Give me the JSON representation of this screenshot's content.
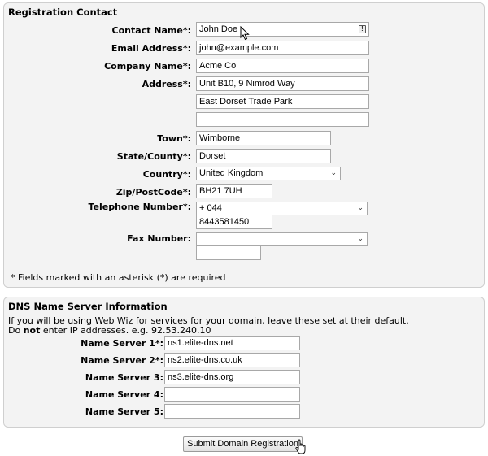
{
  "registration": {
    "title": "Registration Contact",
    "labels": {
      "contact_name": "Contact Name*:",
      "email": "Email Address*:",
      "company": "Company Name*:",
      "address": "Address*:",
      "town": "Town*:",
      "state": "State/County*:",
      "country": "Country*:",
      "zip": "Zip/PostCode*:",
      "telephone": "Telephone Number*:",
      "fax": "Fax Number:"
    },
    "values": {
      "contact_name": "John Doe",
      "email": "john@example.com",
      "company": "Acme Co",
      "address1": "Unit B10, 9 Nimrod Way",
      "address2": "East Dorset Trade Park",
      "address3": "",
      "town": "Wimborne",
      "state": "Dorset",
      "country": "United Kingdom",
      "zip": "BH21 7UH",
      "telephone_code": "+ 044",
      "telephone_number": "8443581450",
      "fax_code": "",
      "fax_number": ""
    },
    "required_note": "* Fields marked with an asterisk (*) are required"
  },
  "dns": {
    "title": "DNS Name Server Information",
    "info_line1": "If you will be using Web Wiz for services for your domain, leave these set at their default.",
    "info_do": "Do ",
    "info_not": "not",
    "info_rest": " enter IP addresses. e.g. 92.53.240.10",
    "labels": [
      "Name Server 1*:",
      "Name Server 2*:",
      "Name Server 3:",
      "Name Server 4:",
      "Name Server 5:"
    ],
    "values": [
      "ns1.elite-dns.net",
      "ns2.elite-dns.co.uk",
      "ns3.elite-dns.org",
      "",
      ""
    ]
  },
  "submit_label": "Submit Domain Registration",
  "icons": [
    "alert-icon",
    "pointer-cursor-icon",
    "hand-cursor-icon",
    "chevron-down-icon"
  ],
  "colors": {
    "panel_bg": "#f3f3f3",
    "panel_border": "#cfcfcf"
  }
}
